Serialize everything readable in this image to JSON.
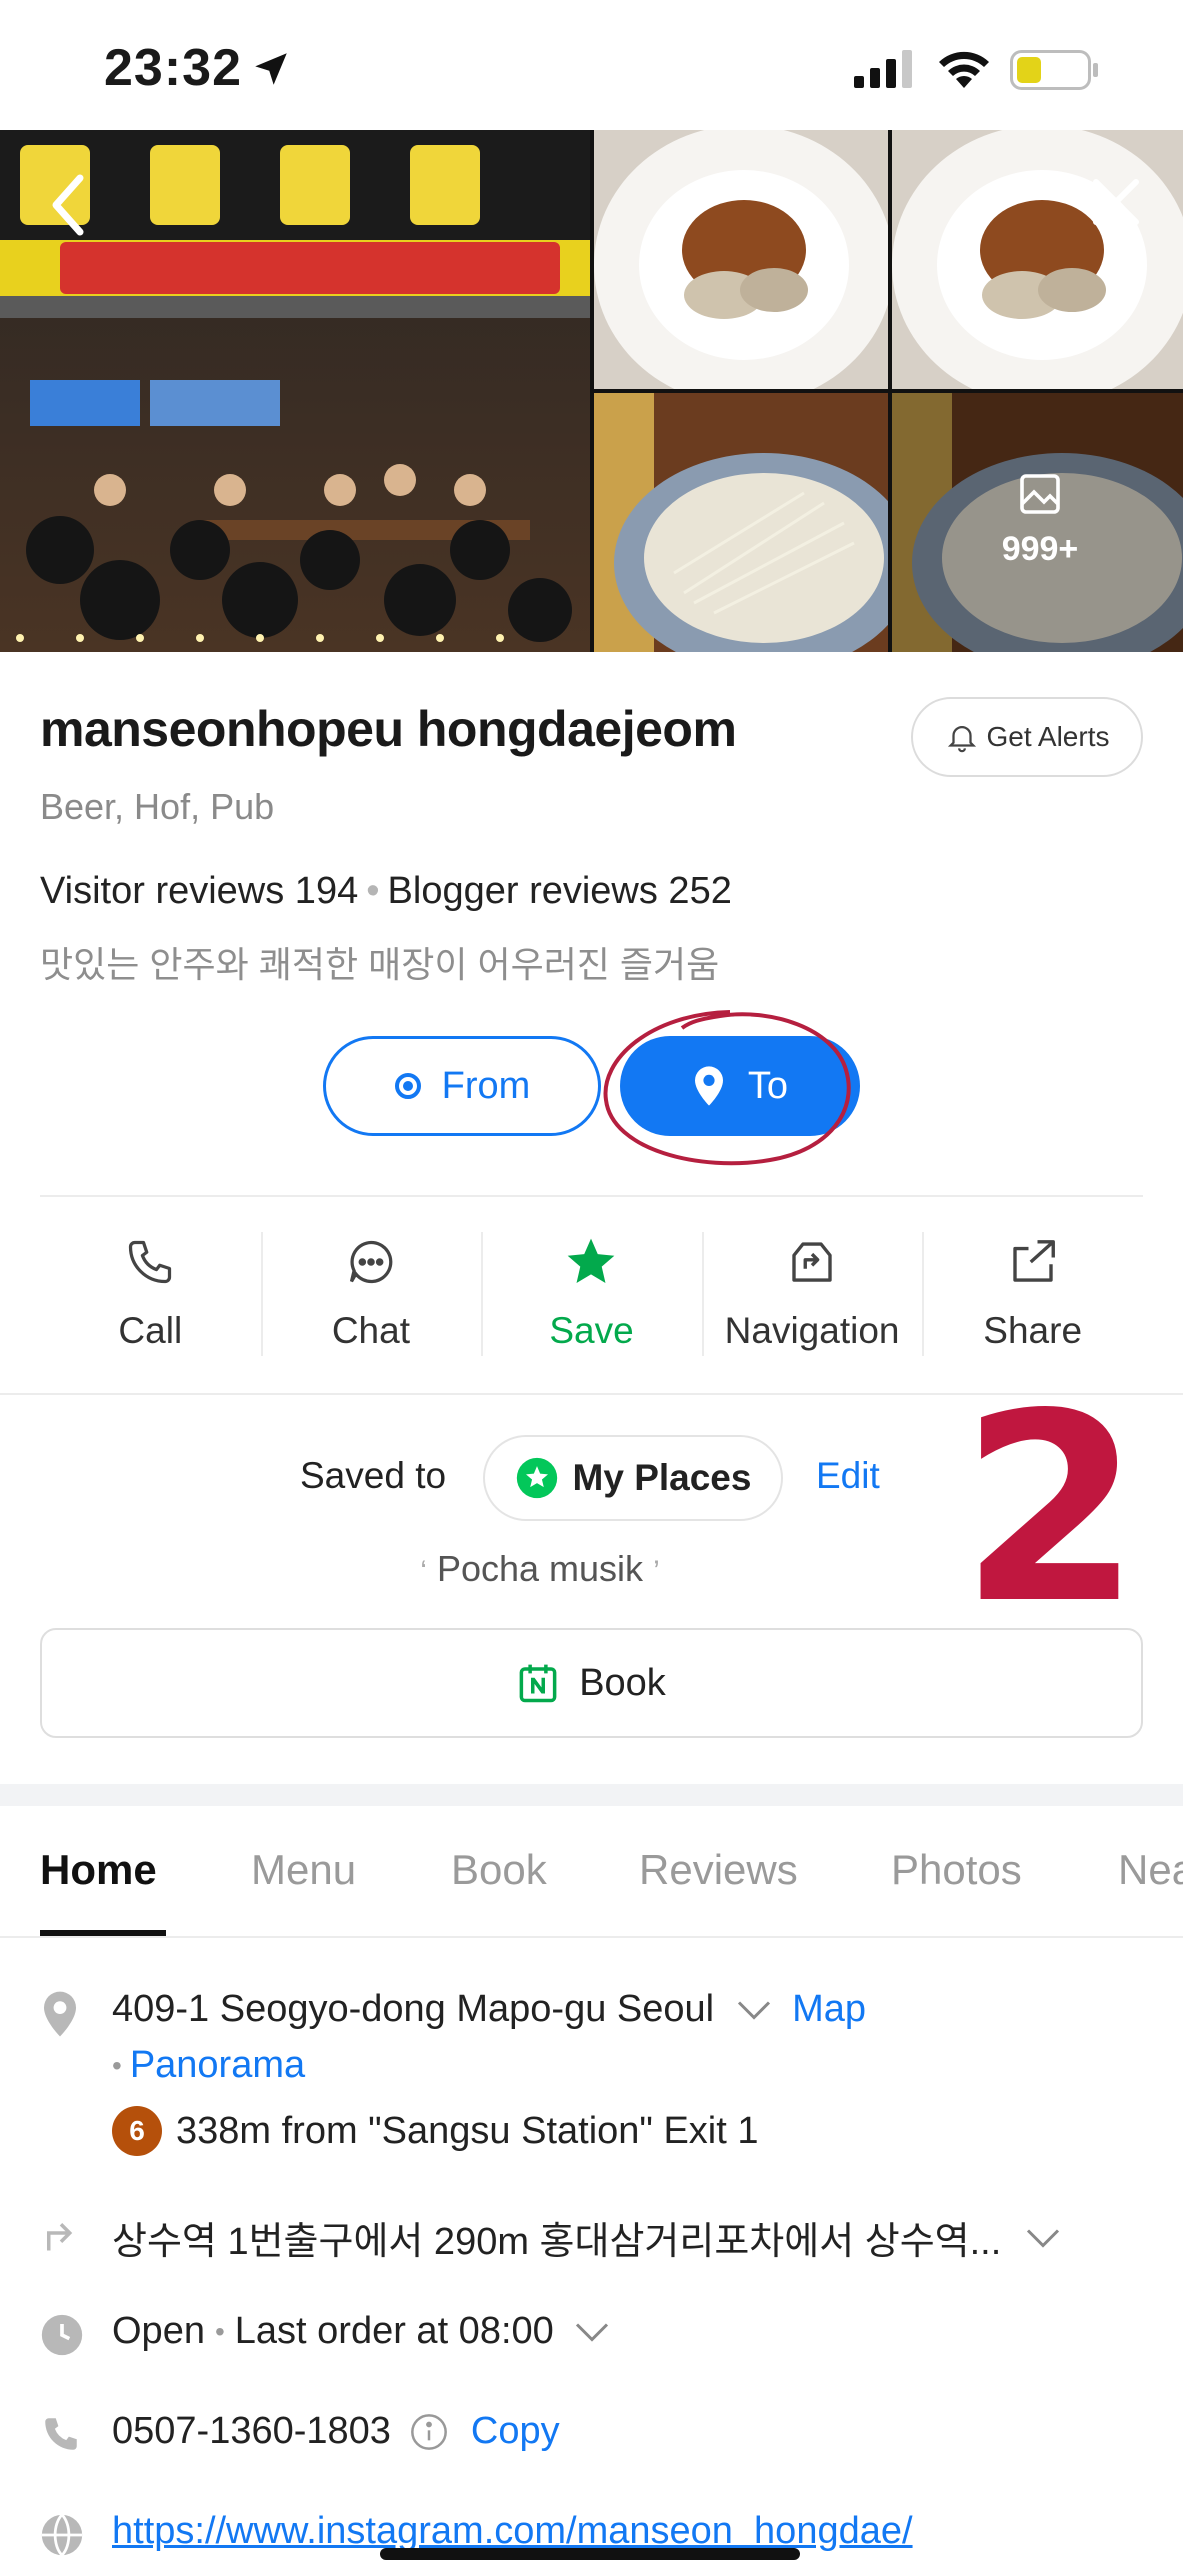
{
  "status_bar": {
    "time": "23:32"
  },
  "gallery": {
    "more_count": "999+"
  },
  "place": {
    "name": "manseonhopeu hongdaejeom",
    "category": "Beer, Hof, Pub",
    "visitor_reviews": "Visitor reviews 194",
    "blogger_reviews": "Blogger reviews 252",
    "tagline": "맛있는 안주와 쾌적한 매장이 어우러진 즐거움"
  },
  "alerts_button": "Get Alerts",
  "route": {
    "from_label": "From",
    "to_label": "To"
  },
  "actions": [
    {
      "label": "Call",
      "icon": "phone-icon"
    },
    {
      "label": "Chat",
      "icon": "chat-icon"
    },
    {
      "label": "Save",
      "icon": "star-icon"
    },
    {
      "label": "Navigation",
      "icon": "navigation-icon"
    },
    {
      "label": "Share",
      "icon": "share-icon"
    }
  ],
  "saved": {
    "label": "Saved to",
    "list": "My Places",
    "edit": "Edit",
    "list_name": "Pocha musik"
  },
  "annotation_number": "2",
  "book_button": "Book",
  "tabs": [
    "Home",
    "Menu",
    "Book",
    "Reviews",
    "Photos",
    "Nea"
  ],
  "info": {
    "address": "409-1 Seogyo-dong Mapo-gu Seoul",
    "map_link": "Map",
    "panorama_link": "Panorama",
    "subway_line": "6",
    "station_distance": "338m from \"Sangsu Station\" Exit 1",
    "directions": "상수역 1번출구에서 290m 홍대삼거리포차에서 상수역...",
    "open_status": "Open",
    "last_order": "Last order at 08:00",
    "phone": "0507-1360-1803",
    "copy": "Copy",
    "website": "https://www.instagram.com/manseon_hongdae/"
  },
  "colors": {
    "accent": "#1278f3",
    "save_green": "#03a94c",
    "annotation": "#c0173f",
    "subway_line_6": "#b5500b"
  }
}
